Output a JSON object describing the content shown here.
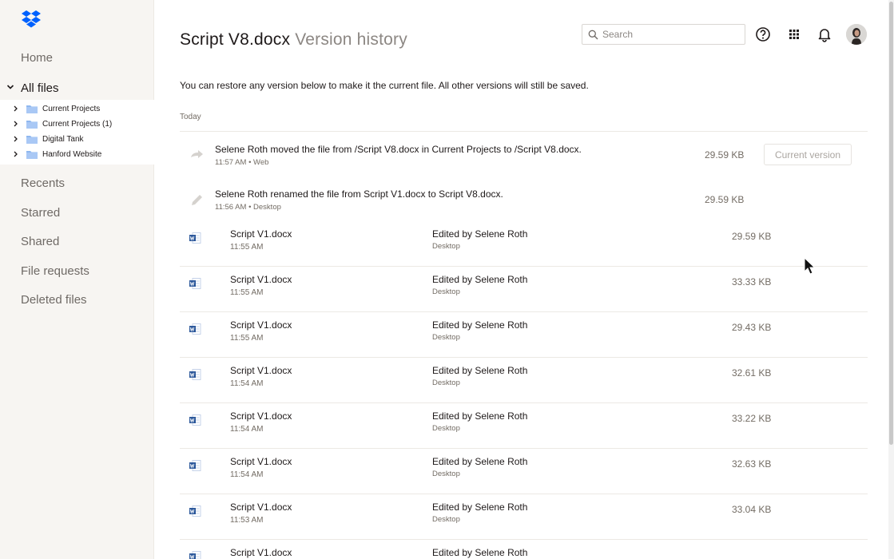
{
  "colors": {
    "brand": "#0061fe",
    "word": "#2b579a",
    "text": "#1e1919",
    "muted": "#736c64",
    "sidebar_bg": "#f7f5f2"
  },
  "sidebar": {
    "home": "Home",
    "all_files": "All files",
    "tree": [
      {
        "label": "Current Projects"
      },
      {
        "label": "Current Projects (1)"
      },
      {
        "label": "Digital Tank"
      },
      {
        "label": "Hanford Website"
      }
    ],
    "recents": "Recents",
    "starred": "Starred",
    "shared": "Shared",
    "file_requests": "File requests",
    "deleted_files": "Deleted files"
  },
  "header": {
    "file_name": "Script V8.docx",
    "subtitle": "Version history",
    "search_placeholder": "Search"
  },
  "description": "You can restore any version below to make it the current file. All other versions will still be saved.",
  "section_label": "Today",
  "events": [
    {
      "text": "Selene Roth moved the file from /Script V8.docx in Current Projects to /Script V8.docx.",
      "meta": "11:57 AM • Web",
      "size": "29.59 KB",
      "icon": "move-arrow-icon",
      "button": "Current version"
    },
    {
      "text": "Selene Roth renamed the file from Script V1.docx to Script V8.docx.",
      "meta": "11:56 AM • Desktop",
      "size": "29.59 KB",
      "icon": "pencil-icon"
    }
  ],
  "versions": [
    {
      "name": "Script V1.docx",
      "time": "11:55 AM",
      "editor": "Edited by Selene Roth",
      "device": "Desktop",
      "size": "29.59 KB"
    },
    {
      "name": "Script V1.docx",
      "time": "11:55 AM",
      "editor": "Edited by Selene Roth",
      "device": "Desktop",
      "size": "33.33 KB"
    },
    {
      "name": "Script V1.docx",
      "time": "11:55 AM",
      "editor": "Edited by Selene Roth",
      "device": "Desktop",
      "size": "29.43 KB"
    },
    {
      "name": "Script V1.docx",
      "time": "11:54 AM",
      "editor": "Edited by Selene Roth",
      "device": "Desktop",
      "size": "32.61 KB"
    },
    {
      "name": "Script V1.docx",
      "time": "11:54 AM",
      "editor": "Edited by Selene Roth",
      "device": "Desktop",
      "size": "33.22 KB"
    },
    {
      "name": "Script V1.docx",
      "time": "11:54 AM",
      "editor": "Edited by Selene Roth",
      "device": "Desktop",
      "size": "32.63 KB"
    },
    {
      "name": "Script V1.docx",
      "time": "11:53 AM",
      "editor": "Edited by Selene Roth",
      "device": "Desktop",
      "size": "33.04 KB"
    },
    {
      "name": "Script V1.docx",
      "time": "",
      "editor": "Edited by Selene Roth",
      "device": "",
      "size": ""
    }
  ]
}
